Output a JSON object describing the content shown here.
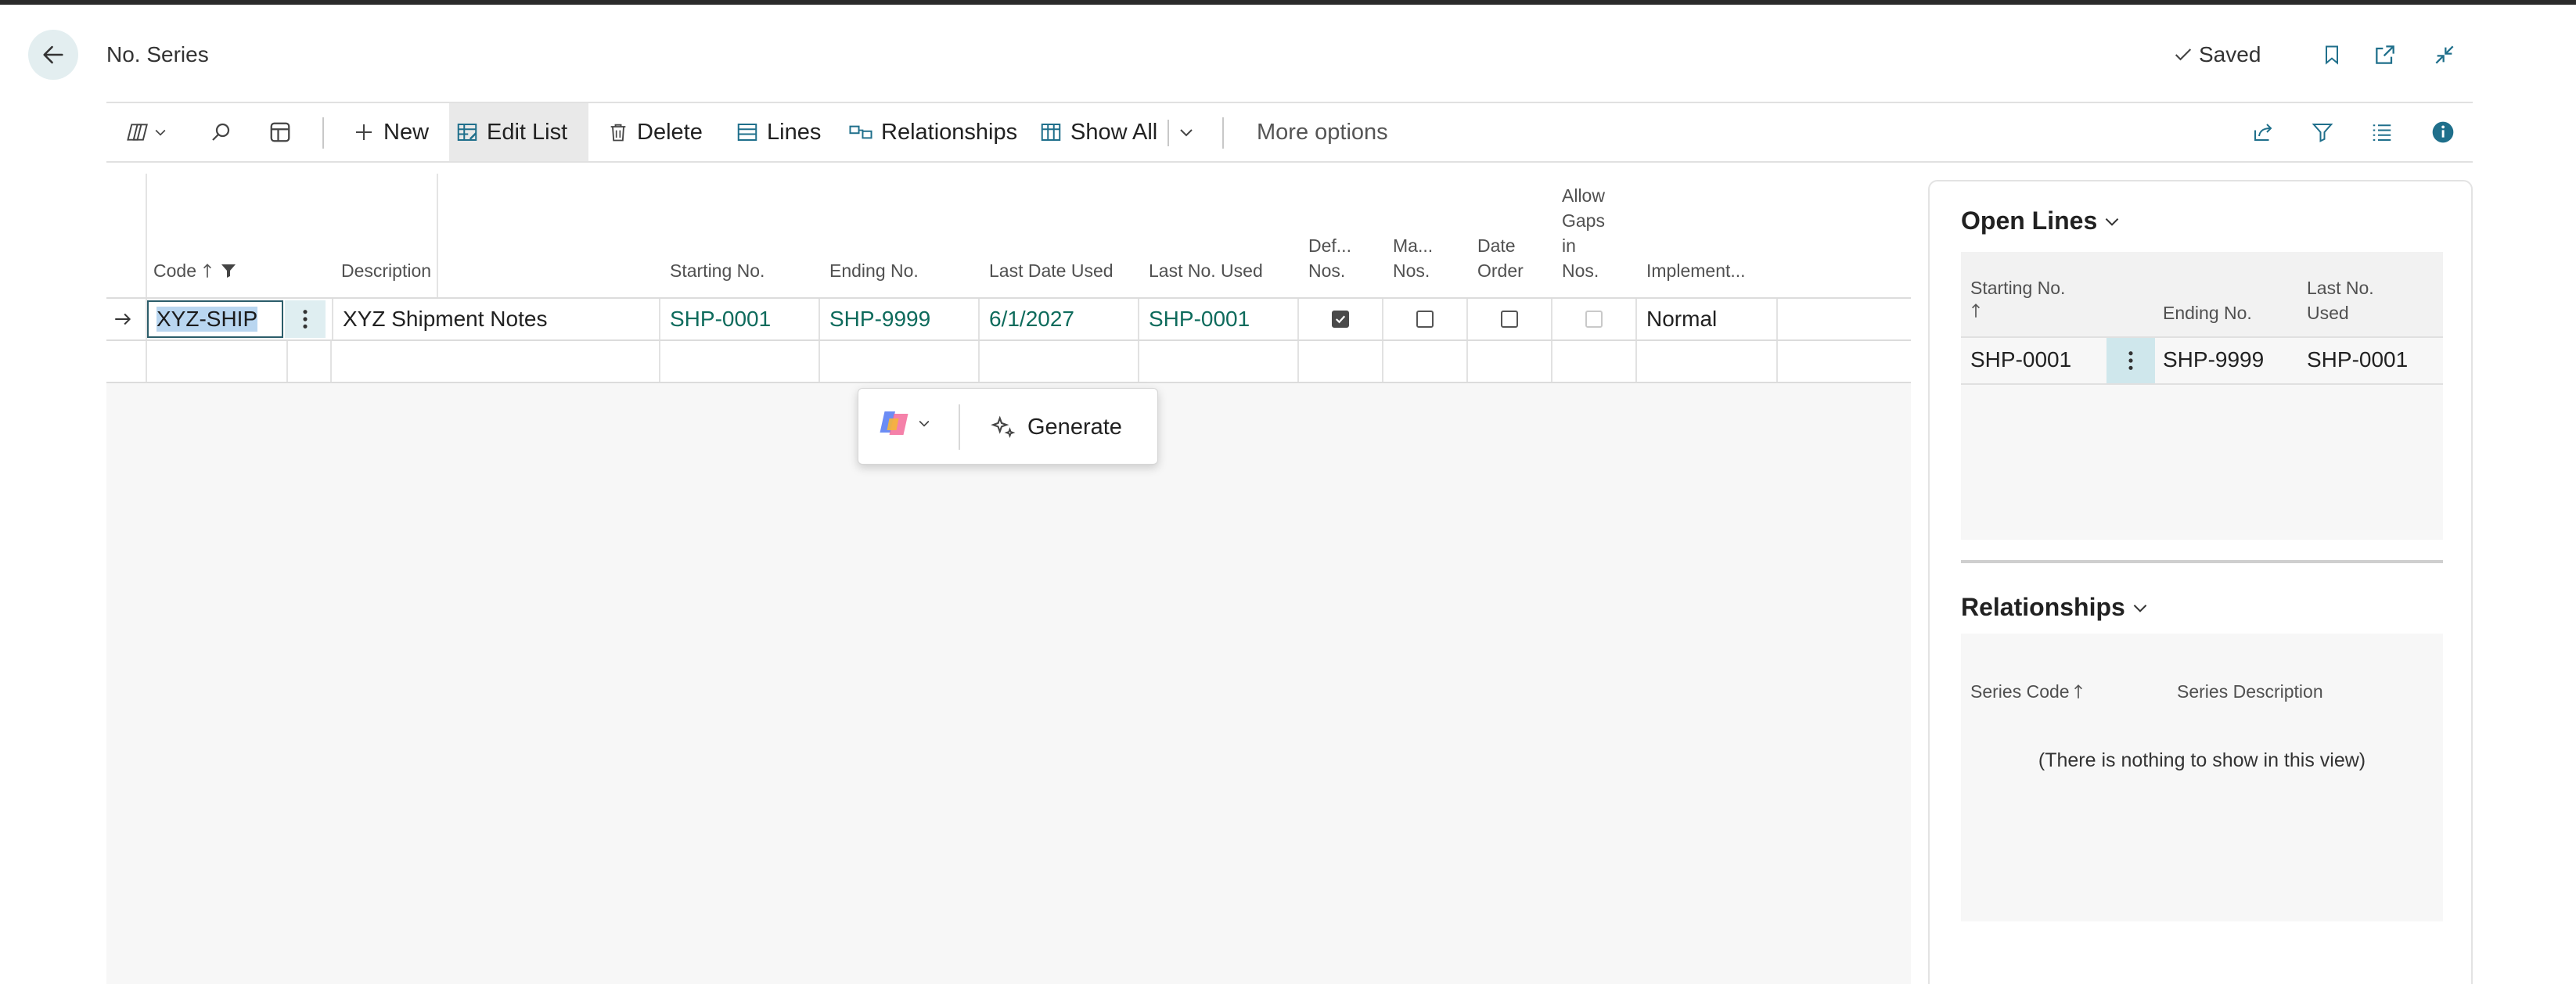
{
  "header": {
    "title": "No. Series",
    "saved_label": "Saved"
  },
  "toolbar": {
    "new_label": "New",
    "edit_list_label": "Edit List",
    "delete_label": "Delete",
    "lines_label": "Lines",
    "relationships_label": "Relationships",
    "show_all_label": "Show All",
    "more_options_label": "More options"
  },
  "grid": {
    "columns": {
      "code": "Code",
      "description": "Description",
      "starting_no": "Starting No.",
      "ending_no": "Ending No.",
      "last_date_used": "Last Date Used",
      "last_no_used": "Last No. Used",
      "default_nos_1": "Def...",
      "default_nos_2": "Nos.",
      "manual_nos_1": "Ma...",
      "manual_nos_2": "Nos.",
      "date_order_1": "Date",
      "date_order_2": "Order",
      "allow_gaps_1": "Allow",
      "allow_gaps_2": "Gaps",
      "allow_gaps_3": "in",
      "allow_gaps_4": "Nos.",
      "implementation": "Implement..."
    },
    "rows": [
      {
        "code": "XYZ-SHIP",
        "description": "XYZ Shipment Notes",
        "starting_no": "SHP-0001",
        "ending_no": "SHP-9999",
        "last_date_used": "6/1/2027",
        "last_no_used": "SHP-0001",
        "default_nos": true,
        "manual_nos": false,
        "date_order": false,
        "allow_gaps": false,
        "implementation": "Normal"
      }
    ]
  },
  "copilot": {
    "generate_label": "Generate"
  },
  "factbox": {
    "open_lines": {
      "title": "Open Lines",
      "col_starting": "Starting No.",
      "col_ending": "Ending No.",
      "col_last_1": "Last No.",
      "col_last_2": "Used",
      "row": {
        "starting_no": "SHP-0001",
        "ending_no": "SHP-9999",
        "last_no_used": "SHP-0001"
      }
    },
    "relationships": {
      "title": "Relationships",
      "col_series_code": "Series Code",
      "col_series_description": "Series Description",
      "empty_text": "(There is nothing to show in this view)"
    }
  },
  "colors": {
    "accent": "#0e6b5c",
    "info": "#1f6f8b"
  }
}
